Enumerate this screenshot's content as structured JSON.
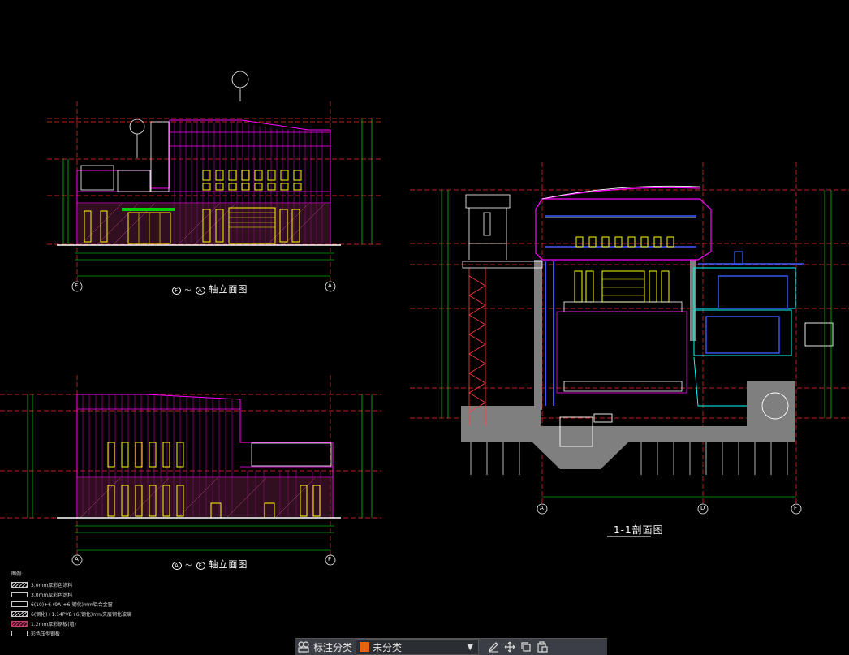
{
  "drawing": {
    "elevations": [
      {
        "title": "Ⓕ～Ⓐ 轴立面图",
        "title_text": "轴立面图",
        "axis_from": "F",
        "axis_to": "A",
        "grid_left": "F",
        "grid_right": "A"
      },
      {
        "title": "Ⓐ～Ⓕ 轴立面图",
        "title_text": "轴立面图",
        "axis_from": "A",
        "axis_to": "F",
        "grid_left": "A",
        "grid_right": "F"
      }
    ],
    "section": {
      "title": "1-1剖面图",
      "grid_labels": [
        "A",
        "D",
        "F"
      ]
    },
    "legend": {
      "heading": "图例:",
      "items": [
        {
          "text": "3.0mm厚彩色涂料",
          "pattern": "hatch"
        },
        {
          "text": "3.0mm厚彩色涂料",
          "pattern": "plain"
        },
        {
          "text": "6(10)+6 (9A)+6(钢化)mm铝合金窗",
          "pattern": "plain"
        },
        {
          "text": "6(钢化)+1.14PVB+6(钢化)mm夹层钢化玻璃",
          "pattern": "hatch"
        },
        {
          "text": "1.2mm厚彩钢板(墙)",
          "pattern": "red"
        },
        {
          "text": "彩色压型钢板",
          "pattern": "plain"
        }
      ]
    },
    "colors": {
      "magenta": "#ff00ff",
      "yellow": "#ffff00",
      "red_axis": "#ff2a2a",
      "green_dim": "#00ff00",
      "cyan": "#00ffff",
      "blue": "#3a5bff",
      "white": "#ffffff",
      "grey_fill": "#7f7f7f"
    }
  },
  "toolbar": {
    "label": "标注分类",
    "selected": "未分类",
    "selected_color": "#e8620c",
    "icons": [
      "classify-icon",
      "edit-icon",
      "move-icon",
      "copy-icon",
      "paste-icon"
    ]
  }
}
